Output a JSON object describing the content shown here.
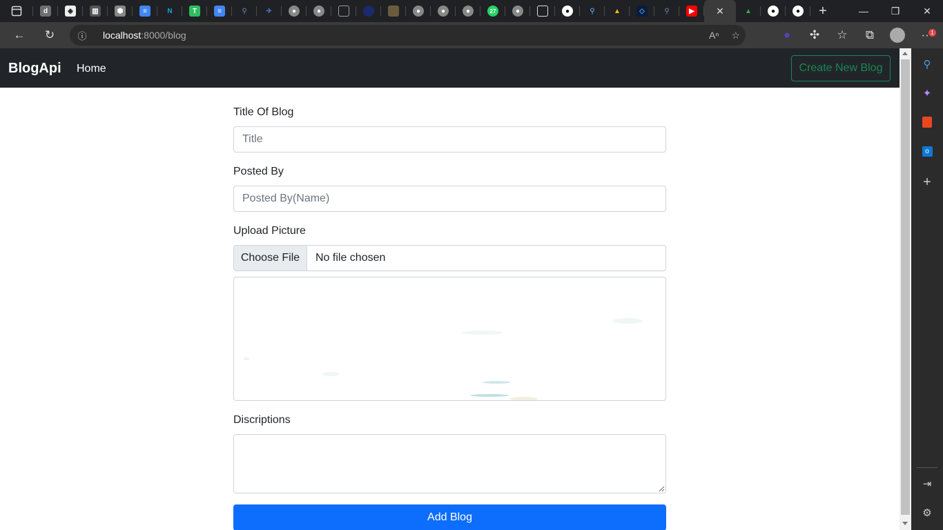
{
  "browser": {
    "url_host": "localhost",
    "url_rest": ":8000/blog",
    "notification_count": "1",
    "whatsapp_badge": "27"
  },
  "navbar": {
    "brand": "BlogApi",
    "home": "Home",
    "create_button": "Create New Blog"
  },
  "form": {
    "title_label": "Title Of Blog",
    "title_placeholder": "Title",
    "posted_by_label": "Posted By",
    "posted_by_placeholder": "Posted By(Name)",
    "upload_label": "Upload Picture",
    "choose_file": "Choose File",
    "no_file": "No file chosen",
    "description_label": "Discriptions",
    "submit": "Add Blog"
  },
  "colors": {
    "navbar_bg": "#212529",
    "success": "#198754",
    "primary": "#0d6efd"
  }
}
